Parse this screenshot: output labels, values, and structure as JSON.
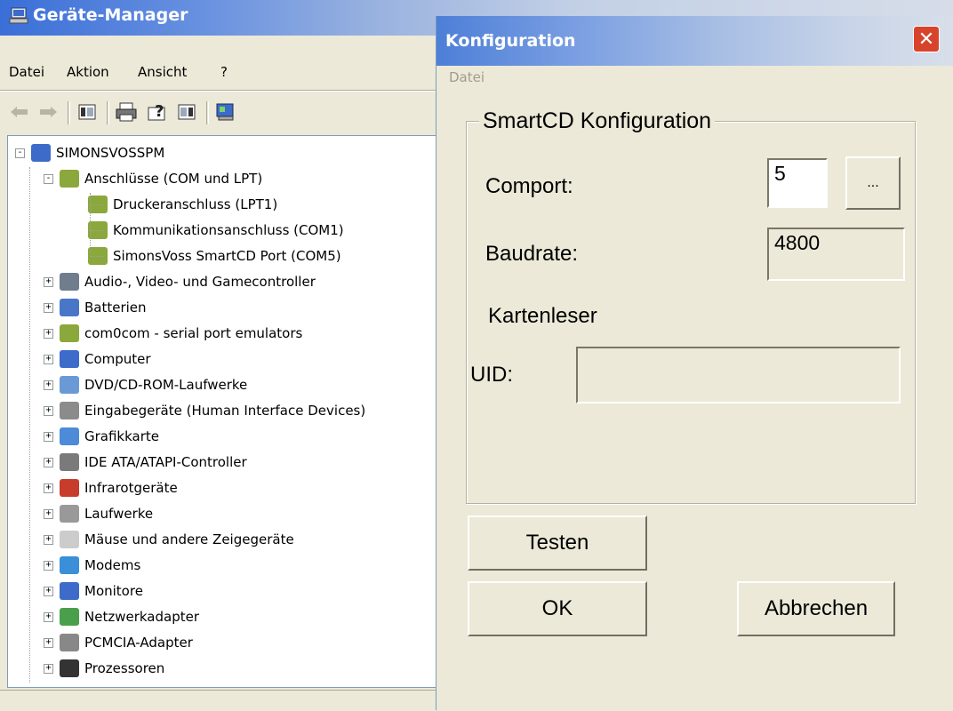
{
  "device_manager": {
    "title": "Geräte-Manager",
    "menu": [
      "Datei",
      "Aktion",
      "Ansicht",
      "?"
    ],
    "toolbar_icons": [
      "back-arrow-icon",
      "forward-arrow-icon",
      "properties-grid-icon",
      "printer-icon",
      "help-icon",
      "view-icon",
      "scan-hardware-icon"
    ],
    "tree": {
      "root": "SIMONSVOSSPM",
      "expanded": {
        "label": "Anschlüsse (COM und LPT)",
        "children": [
          "Druckeranschluss (LPT1)",
          "Kommunikationsanschluss (COM1)",
          "SimonsVoss SmartCD Port (COM5)"
        ]
      },
      "categories": [
        "Audio-, Video- und Gamecontroller",
        "Batterien",
        "com0com - serial port emulators",
        "Computer",
        "DVD/CD-ROM-Laufwerke",
        "Eingabegeräte (Human Interface Devices)",
        "Grafikkarte",
        "IDE ATA/ATAPI-Controller",
        "Infrarotgeräte",
        "Laufwerke",
        "Mäuse und andere Zeigegeräte",
        "Modems",
        "Monitore",
        "Netzwerkadapter",
        "PCMCIA-Adapter",
        "Prozessoren"
      ]
    }
  },
  "dialog": {
    "title": "Konfiguration",
    "menu": "Datei",
    "group_title": "SmartCD Konfiguration",
    "comport_label": "Comport:",
    "comport_value": "5",
    "browse_label": "...",
    "baudrate_label": "Baudrate:",
    "baudrate_value": "4800",
    "kartenleser_label": "Kartenleser",
    "kartenleser_checked": false,
    "uid_label": "UID:",
    "uid_value": "",
    "buttons": {
      "test": "Testen",
      "ok": "OK",
      "cancel": "Abbrechen"
    }
  }
}
